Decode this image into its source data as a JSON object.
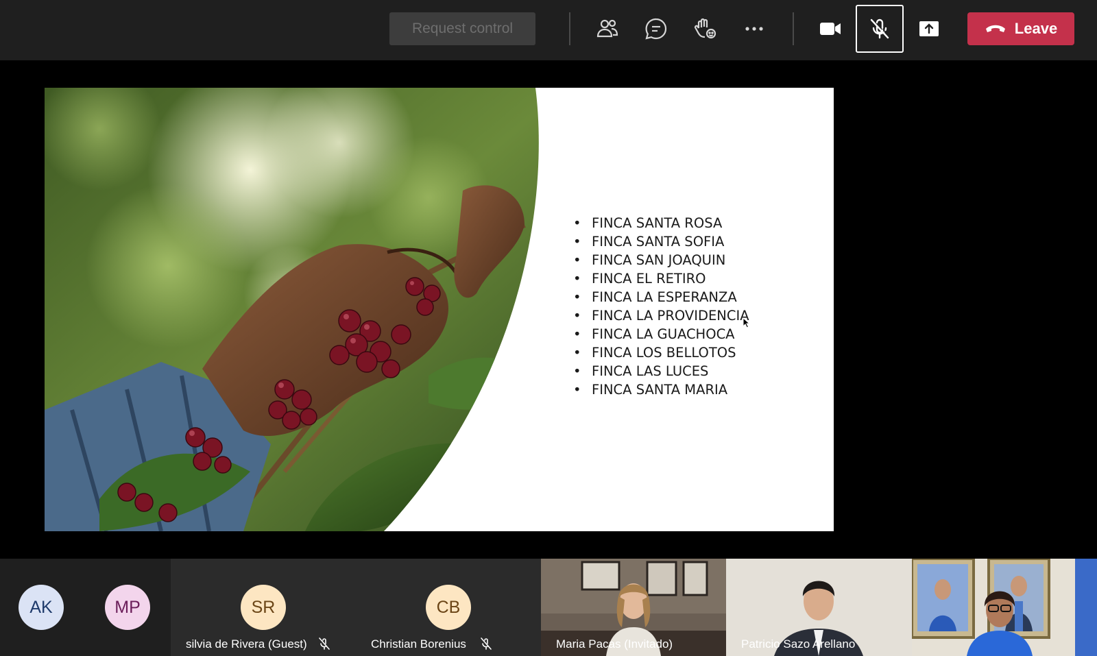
{
  "toolbar": {
    "request_control_label": "Request control",
    "leave_label": "Leave",
    "icons": [
      "people-icon",
      "chat-icon",
      "raise-hand-icon",
      "more-icon",
      "camera-icon",
      "mic-off-icon",
      "share-icon"
    ],
    "leave_color": "#c4314b"
  },
  "slide": {
    "items": [
      "FINCA SANTA ROSA",
      "FINCA SANTA SOFIA",
      "FINCA SAN JOAQUIN",
      "FINCA EL RETIRO",
      "FINCA LA ESPERANZA",
      "FINCA LA PROVIDENCIA",
      "FINCA LA GUACHOCA",
      "FINCA LOS BELLOTOS",
      "FINCA LAS LUCES",
      "FINCA SANTA MARIA"
    ]
  },
  "participants": [
    {
      "initials": "AK",
      "name": "",
      "color": "#dbe3f5",
      "text_color": "#1e3a6b"
    },
    {
      "initials": "MP",
      "name": "",
      "color": "#f3d5ec",
      "text_color": "#6b1e5a"
    },
    {
      "initials": "SR",
      "name": "silvia de Rivera (Guest)",
      "color": "#fde6c2",
      "text_color": "#6b4516",
      "muted": true
    },
    {
      "initials": "CB",
      "name": "Christian Borenius",
      "color": "#fde6c2",
      "text_color": "#6b4516",
      "muted": true
    },
    {
      "initials": "",
      "name": "Maria Pacas (Invitado)",
      "video": true
    },
    {
      "initials": "",
      "name": "Patricio Sazo Arellano",
      "video": true
    },
    {
      "initials": "",
      "name": "",
      "video": true
    }
  ]
}
